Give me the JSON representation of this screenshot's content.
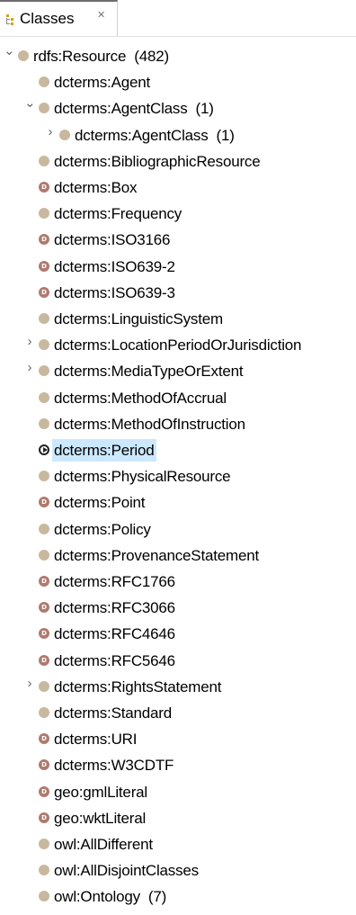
{
  "view": {
    "title": "Classes",
    "close_glyph": "✕",
    "icon": "classes-hierarchy-icon"
  },
  "colors": {
    "class_dot": "#c8b99e",
    "datatype_dot": "#b07a6e",
    "selection": "#cce8ff",
    "twisty": "#6a6a6a"
  },
  "tree": [
    {
      "label": "rdfs:Resource  (482)",
      "kind": "class",
      "twisty": "expanded"
    },
    {
      "label": "dcterms:Agent",
      "kind": "class",
      "twisty": "none"
    },
    {
      "label": "dcterms:AgentClass  (1)",
      "kind": "class",
      "twisty": "expanded"
    },
    {
      "label": "dcterms:AgentClass  (1)",
      "kind": "class",
      "twisty": "collapsed"
    },
    {
      "label": "dcterms:BibliographicResource",
      "kind": "class",
      "twisty": "none"
    },
    {
      "label": "dcterms:Box",
      "kind": "datatype",
      "twisty": "none"
    },
    {
      "label": "dcterms:Frequency",
      "kind": "class",
      "twisty": "none"
    },
    {
      "label": "dcterms:ISO3166",
      "kind": "datatype",
      "twisty": "none"
    },
    {
      "label": "dcterms:ISO639-2",
      "kind": "datatype",
      "twisty": "none"
    },
    {
      "label": "dcterms:ISO639-3",
      "kind": "datatype",
      "twisty": "none"
    },
    {
      "label": "dcterms:LinguisticSystem",
      "kind": "class",
      "twisty": "none"
    },
    {
      "label": "dcterms:LocationPeriodOrJurisdiction",
      "kind": "class",
      "twisty": "collapsed"
    },
    {
      "label": "dcterms:MediaTypeOrExtent",
      "kind": "class",
      "twisty": "collapsed"
    },
    {
      "label": "dcterms:MethodOfAccrual",
      "kind": "class",
      "twisty": "none"
    },
    {
      "label": "dcterms:MethodOfInstruction",
      "kind": "class",
      "twisty": "none"
    },
    {
      "label": "dcterms:Period",
      "kind": "selected",
      "twisty": "none",
      "selected": true
    },
    {
      "label": "dcterms:PhysicalResource",
      "kind": "class",
      "twisty": "none"
    },
    {
      "label": "dcterms:Point",
      "kind": "datatype",
      "twisty": "none"
    },
    {
      "label": "dcterms:Policy",
      "kind": "class",
      "twisty": "none"
    },
    {
      "label": "dcterms:ProvenanceStatement",
      "kind": "class",
      "twisty": "none"
    },
    {
      "label": "dcterms:RFC1766",
      "kind": "datatype",
      "twisty": "none"
    },
    {
      "label": "dcterms:RFC3066",
      "kind": "datatype",
      "twisty": "none"
    },
    {
      "label": "dcterms:RFC4646",
      "kind": "datatype",
      "twisty": "none"
    },
    {
      "label": "dcterms:RFC5646",
      "kind": "datatype",
      "twisty": "none"
    },
    {
      "label": "dcterms:RightsStatement",
      "kind": "class",
      "twisty": "collapsed"
    },
    {
      "label": "dcterms:Standard",
      "kind": "class",
      "twisty": "none"
    },
    {
      "label": "dcterms:URI",
      "kind": "datatype",
      "twisty": "none"
    },
    {
      "label": "dcterms:W3CDTF",
      "kind": "datatype",
      "twisty": "none"
    },
    {
      "label": "geo:gmlLiteral",
      "kind": "datatype",
      "twisty": "none"
    },
    {
      "label": "geo:wktLiteral",
      "kind": "datatype",
      "twisty": "none"
    },
    {
      "label": "owl:AllDifferent",
      "kind": "class",
      "twisty": "none"
    },
    {
      "label": "owl:AllDisjointClasses",
      "kind": "class",
      "twisty": "none"
    },
    {
      "label": "owl:Ontology  (7)",
      "kind": "class",
      "twisty": "none"
    }
  ]
}
